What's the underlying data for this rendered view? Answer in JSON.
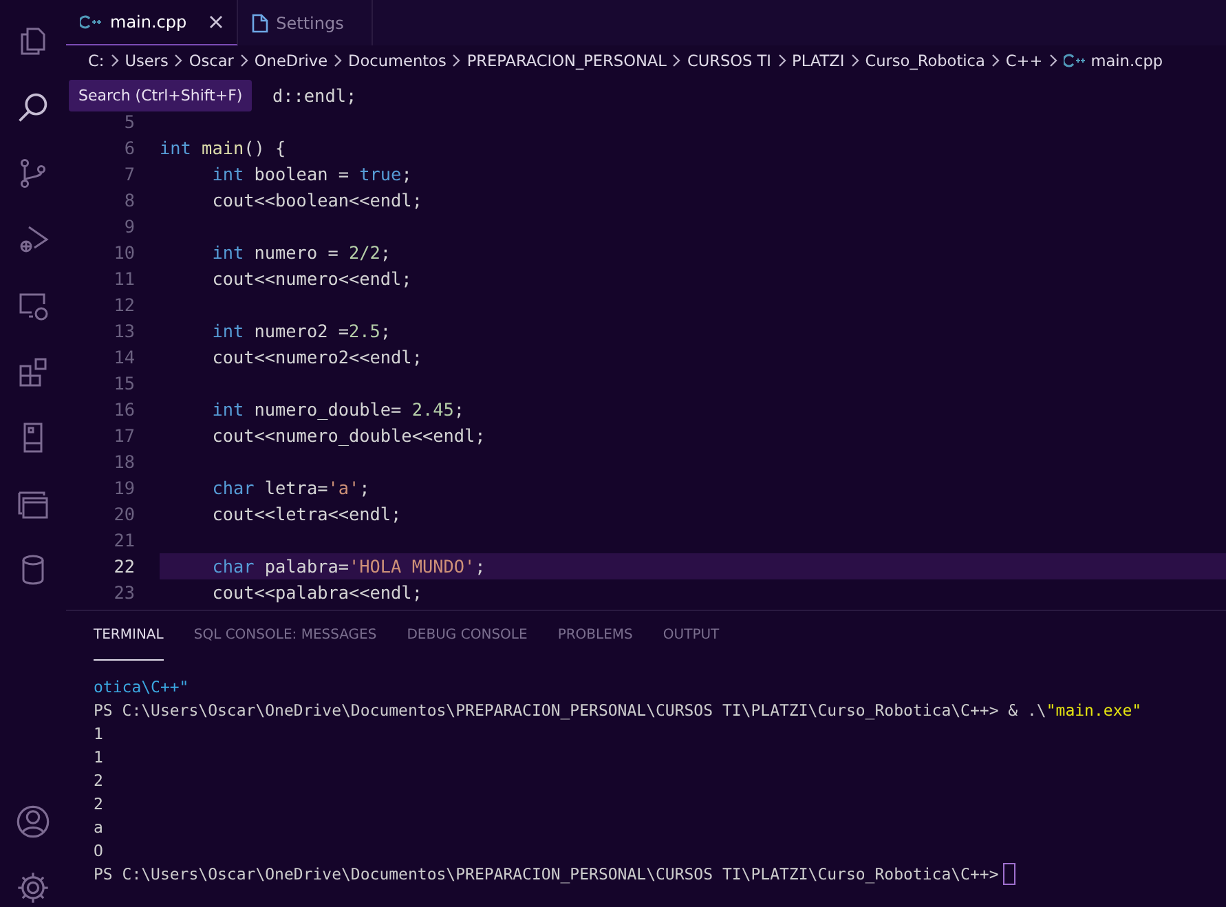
{
  "activity_bar": {
    "top": [
      {
        "kind": "explorer"
      },
      {
        "kind": "search"
      },
      {
        "kind": "source-control"
      },
      {
        "kind": "run-debug"
      },
      {
        "kind": "remote"
      },
      {
        "kind": "extensions"
      },
      {
        "kind": "device"
      },
      {
        "kind": "panels"
      },
      {
        "kind": "database"
      }
    ],
    "bottom": [
      {
        "kind": "account"
      },
      {
        "kind": "settings"
      }
    ]
  },
  "tabs": [
    {
      "label": "main.cpp",
      "kind": "cpp",
      "selected": true,
      "closable": true
    },
    {
      "label": "Settings",
      "kind": "settings",
      "selected": false,
      "closable": false
    }
  ],
  "breadcrumb": [
    {
      "label": "C:",
      "kind": "folder"
    },
    {
      "label": "Users",
      "kind": "folder"
    },
    {
      "label": "Oscar",
      "kind": "folder"
    },
    {
      "label": "OneDrive",
      "kind": "folder"
    },
    {
      "label": "Documentos",
      "kind": "folder"
    },
    {
      "label": "PREPARACION_PERSONAL",
      "kind": "folder"
    },
    {
      "label": "CURSOS TI",
      "kind": "folder"
    },
    {
      "label": "PLATZI",
      "kind": "folder"
    },
    {
      "label": "Curso_Robotica",
      "kind": "folder"
    },
    {
      "label": "C++",
      "kind": "folder"
    },
    {
      "label": "main.cpp",
      "kind": "cpp"
    }
  ],
  "tooltip": {
    "text": "Search (Ctrl+Shift+F)"
  },
  "editor": {
    "lines": [
      {
        "selected": false,
        "tokens": [
          {
            "t": "d::endl;",
            "kind": "plain"
          }
        ]
      },
      {
        "number": "5",
        "selected": false
      },
      {
        "number": "6",
        "selected": false,
        "tokens": [
          {
            "t": "int",
            "kind": "kw"
          },
          {
            "t": " main",
            "kind": "fn"
          },
          {
            "t": "() {",
            "kind": "plain"
          }
        ]
      },
      {
        "number": "7",
        "selected": false,
        "tokens": [
          {
            "t": "     int",
            "kind": "kw"
          },
          {
            "t": " boolean = ",
            "kind": "plain"
          },
          {
            "t": "true",
            "kind": "kw"
          },
          {
            "t": ";",
            "kind": "plain"
          }
        ]
      },
      {
        "number": "8",
        "selected": false,
        "tokens": [
          {
            "t": "     cout<<boolean<<endl;",
            "kind": "plain"
          }
        ]
      },
      {
        "number": "9",
        "selected": false
      },
      {
        "number": "10",
        "selected": false,
        "tokens": [
          {
            "t": "     int",
            "kind": "kw"
          },
          {
            "t": " numero = ",
            "kind": "plain"
          },
          {
            "t": "2/2",
            "kind": "num"
          },
          {
            "t": ";",
            "kind": "plain"
          }
        ]
      },
      {
        "number": "11",
        "selected": false,
        "tokens": [
          {
            "t": "     cout<<numero<<endl;",
            "kind": "plain"
          }
        ]
      },
      {
        "number": "12",
        "selected": false
      },
      {
        "number": "13",
        "selected": false,
        "tokens": [
          {
            "t": "     int",
            "kind": "kw"
          },
          {
            "t": " numero2 =",
            "kind": "plain"
          },
          {
            "t": "2.5",
            "kind": "num"
          },
          {
            "t": ";",
            "kind": "plain"
          }
        ]
      },
      {
        "number": "14",
        "selected": false,
        "tokens": [
          {
            "t": "     cout<<numero2<<endl;",
            "kind": "plain"
          }
        ]
      },
      {
        "number": "15",
        "selected": false
      },
      {
        "number": "16",
        "selected": false,
        "tokens": [
          {
            "t": "     int",
            "kind": "kw"
          },
          {
            "t": " numero_double= ",
            "kind": "plain"
          },
          {
            "t": "2.45",
            "kind": "num"
          },
          {
            "t": ";",
            "kind": "plain"
          }
        ]
      },
      {
        "number": "17",
        "selected": false,
        "tokens": [
          {
            "t": "     cout<<numero_double<<endl;",
            "kind": "plain"
          }
        ]
      },
      {
        "number": "18",
        "selected": false
      },
      {
        "number": "19",
        "selected": false,
        "tokens": [
          {
            "t": "     char",
            "kind": "kw"
          },
          {
            "t": " letra=",
            "kind": "plain"
          },
          {
            "t": "'a'",
            "kind": "str"
          },
          {
            "t": ";",
            "kind": "plain"
          }
        ]
      },
      {
        "number": "20",
        "selected": false,
        "tokens": [
          {
            "t": "     cout<<letra<<endl;",
            "kind": "plain"
          }
        ]
      },
      {
        "number": "21",
        "selected": false
      },
      {
        "number": "22",
        "selected": true,
        "tokens": [
          {
            "t": "     char",
            "kind": "kw"
          },
          {
            "t": " palabra=",
            "kind": "plain"
          },
          {
            "t": "'HOLA MUNDO'",
            "kind": "str"
          },
          {
            "t": ";",
            "kind": "plain"
          }
        ]
      },
      {
        "number": "23",
        "selected": false,
        "tokens": [
          {
            "t": "     cout<<palabra<<endl;",
            "kind": "plain"
          }
        ]
      }
    ]
  },
  "panel": {
    "tabs": [
      {
        "label": "TERMINAL",
        "selected": true
      },
      {
        "label": "SQL CONSOLE: MESSAGES",
        "selected": false
      },
      {
        "label": "DEBUG CONSOLE",
        "selected": false
      },
      {
        "label": "PROBLEMS",
        "selected": false
      },
      {
        "label": "OUTPUT",
        "selected": false
      }
    ],
    "cursor": true,
    "terminal_lines": [
      {
        "tokens": [
          {
            "t": "otica\\C++\"",
            "kind": "path"
          }
        ]
      },
      {
        "tokens": [
          {
            "t": "PS C:\\Users\\Oscar\\OneDrive\\Documentos\\PREPARACION_PERSONAL\\CURSOS TI\\PLATZI\\Curso_Robotica\\C++> & .\\",
            "kind": "plain"
          },
          {
            "t": "\"main.exe\"",
            "kind": "str"
          }
        ]
      },
      {
        "tokens": [
          {
            "t": "1",
            "kind": "plain"
          }
        ]
      },
      {
        "tokens": [
          {
            "t": "1",
            "kind": "plain"
          }
        ]
      },
      {
        "tokens": [
          {
            "t": "2",
            "kind": "plain"
          }
        ]
      },
      {
        "tokens": [
          {
            "t": "2",
            "kind": "plain"
          }
        ]
      },
      {
        "tokens": [
          {
            "t": "a",
            "kind": "plain"
          }
        ]
      },
      {
        "tokens": [
          {
            "t": "O",
            "kind": "plain"
          }
        ]
      },
      {
        "tokens": [
          {
            "t": "PS C:\\Users\\Oscar\\OneDrive\\Documentos\\PREPARACION_PERSONAL\\CURSOS TI\\PLATZI\\Curso_Robotica\\C++>",
            "kind": "plain"
          }
        ]
      }
    ]
  }
}
